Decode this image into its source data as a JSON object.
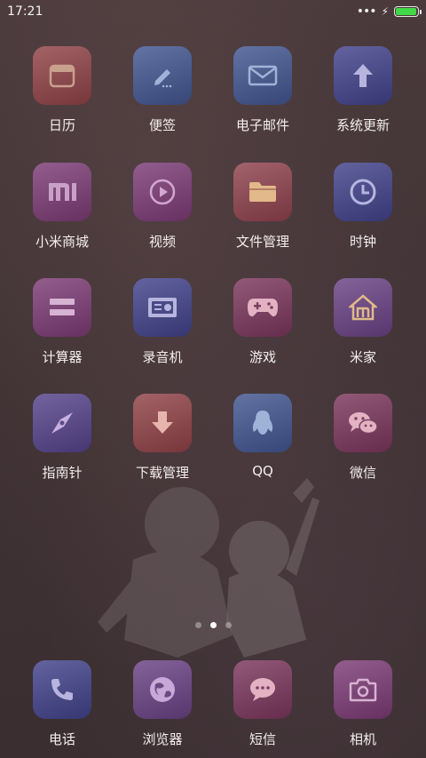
{
  "status_bar": {
    "time": "17:21",
    "battery_color": "#43d847"
  },
  "apps": [
    {
      "label": "日历",
      "icon": "calendar-icon",
      "bg": "#8a4a4e"
    },
    {
      "label": "便签",
      "icon": "note-pencil-icon",
      "bg": "#4a5a8a"
    },
    {
      "label": "电子邮件",
      "icon": "mail-icon",
      "bg": "#4a5a8a"
    },
    {
      "label": "系统更新",
      "icon": "update-arrow-icon",
      "bg": "#4a4a86"
    },
    {
      "label": "小米商城",
      "icon": "mi-store-icon",
      "bg": "#7a4474"
    },
    {
      "label": "视频",
      "icon": "video-play-icon",
      "bg": "#7a4474"
    },
    {
      "label": "文件管理",
      "icon": "folder-icon",
      "bg": "#8a4a54"
    },
    {
      "label": "时钟",
      "icon": "clock-icon",
      "bg": "#4a4a86"
    },
    {
      "label": "计算器",
      "icon": "calculator-icon",
      "bg": "#7a4474"
    },
    {
      "label": "录音机",
      "icon": "recorder-icon",
      "bg": "#4a4a86"
    },
    {
      "label": "游戏",
      "icon": "gamepad-icon",
      "bg": "#7a4060"
    },
    {
      "label": "米家",
      "icon": "mijia-home-icon",
      "bg": "#6a4a80"
    },
    {
      "label": "指南针",
      "icon": "compass-icon",
      "bg": "#5a4a86"
    },
    {
      "label": "下载管理",
      "icon": "download-icon",
      "bg": "#8a4a4e"
    },
    {
      "label": "QQ",
      "icon": "qq-penguin-icon",
      "bg": "#4a5a8a"
    },
    {
      "label": "微信",
      "icon": "wechat-icon",
      "bg": "#7a4060"
    }
  ],
  "dock": [
    {
      "label": "电话",
      "icon": "phone-icon",
      "bg": "#4a4a86"
    },
    {
      "label": "浏览器",
      "icon": "browser-globe-icon",
      "bg": "#6a4a80"
    },
    {
      "label": "短信",
      "icon": "message-icon",
      "bg": "#7a4060"
    },
    {
      "label": "相机",
      "icon": "camera-icon",
      "bg": "#7a4474"
    }
  ],
  "pager": {
    "pages": 3,
    "active_page": 2
  }
}
